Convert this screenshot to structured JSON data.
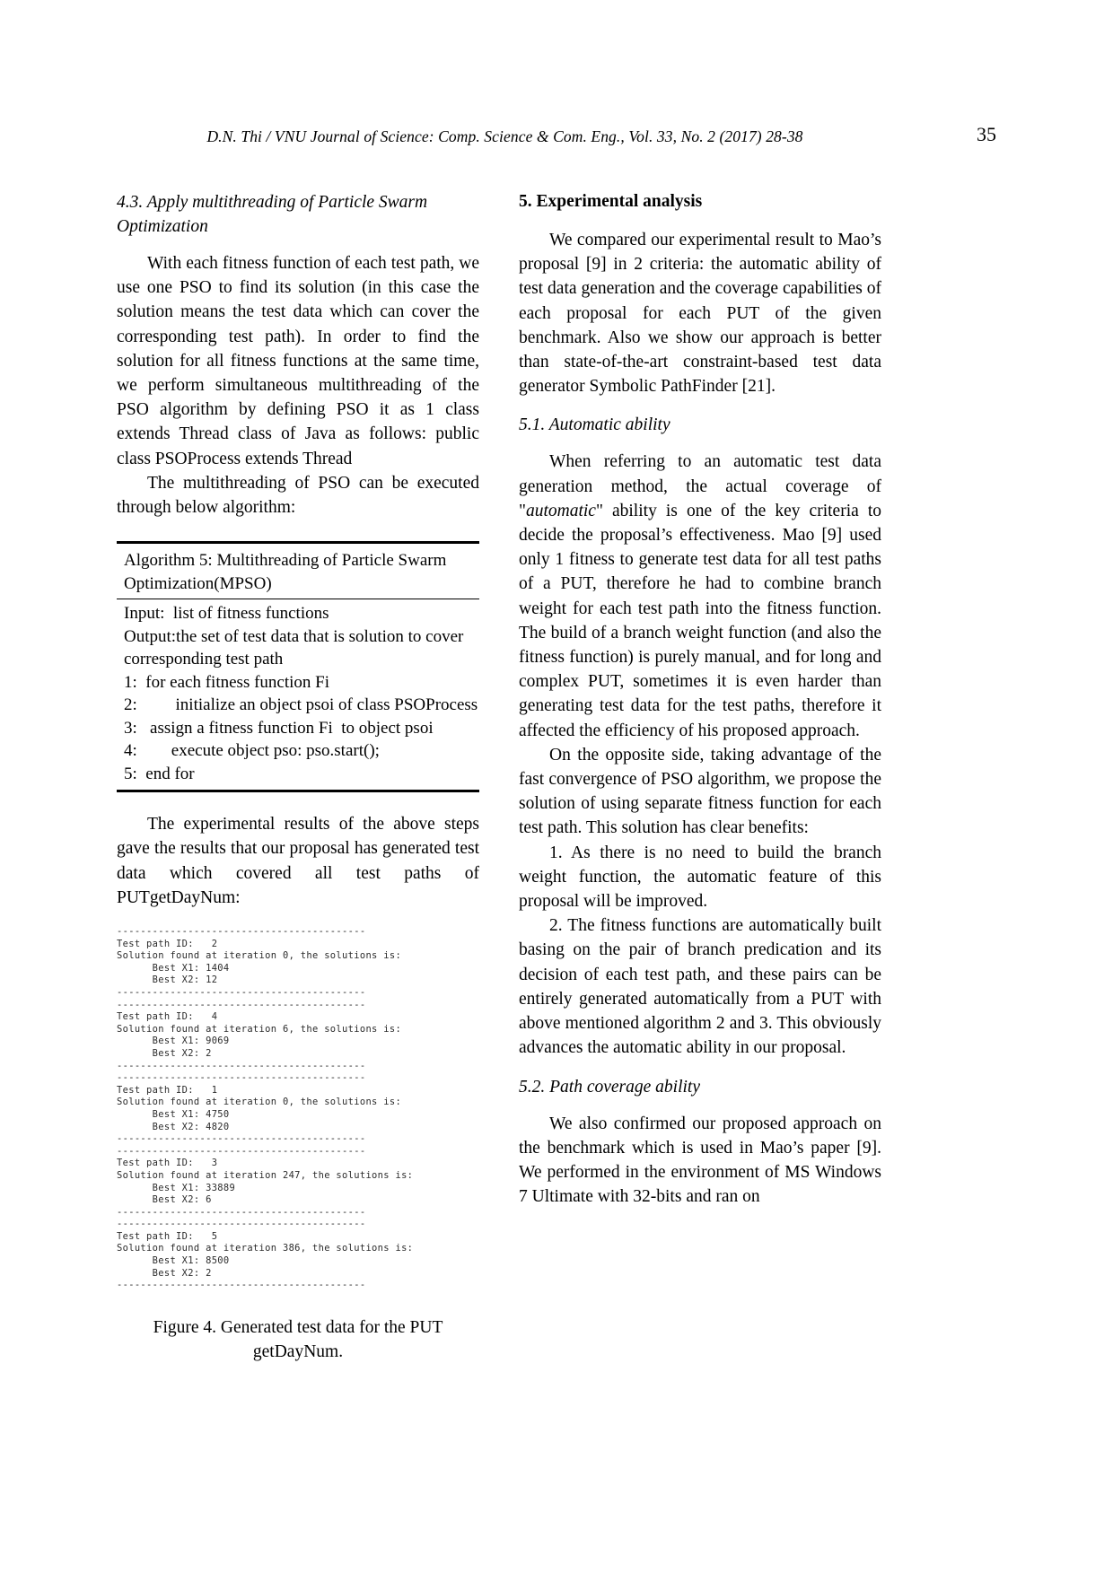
{
  "running_head": {
    "citation": "D.N. Thi / VNU Journal of Science: Comp. Science & Com. Eng., Vol. 33, No. 2 (2017) 28-38",
    "page_number": "35"
  },
  "left_column": {
    "heading_4_3": "4.3. Apply multithreading of Particle Swarm Optimization",
    "para_1": "With each fitness function of each test path, we use one PSO to find its solution (in this case the solution means the test data which can cover the corresponding test path). In order to find the solution for all fitness functions at the same time, we perform simultaneous multithreading of the PSO algorithm by defining PSO it as 1 class extends Thread class of Java as follows: public class PSOProcess extends Thread",
    "para_2": "The multithreading of PSO can be executed through below algorithm:",
    "algorithm": {
      "title": "Algorithm 5: Multithreading of Particle Swarm Optimization(MPSO)",
      "lines": [
        "Input:  list of fitness functions",
        "Output:the set of test data that is solution to cover corresponding test path",
        "1:  for each fitness function Fi",
        "2:         initialize an object psoi of class PSOProcess",
        "3:   assign a fitness function Fi  to object psoi",
        "4:        execute object pso: pso.start();",
        "5:  end for"
      ]
    },
    "para_3": "The experimental results of the above steps gave the results that our proposal has generated test data which covered all test paths of PUTgetDayNum:",
    "console_output": "------------------------------------------\nTest path ID:   2\nSolution found at iteration 0, the solutions is:\n      Best X1: 1404\n      Best X2: 12\n------------------------------------------\n------------------------------------------\nTest path ID:   4\nSolution found at iteration 6, the solutions is:\n      Best X1: 9069\n      Best X2: 2\n------------------------------------------\n------------------------------------------\nTest path ID:   1\nSolution found at iteration 0, the solutions is:\n      Best X1: 4750\n      Best X2: 4820\n------------------------------------------\n------------------------------------------\nTest path ID:   3\nSolution found at iteration 247, the solutions is:\n      Best X1: 33889\n      Best X2: 6\n------------------------------------------\n------------------------------------------\nTest path ID:   5\nSolution found at iteration 386, the solutions is:\n      Best X1: 8500\n      Best X2: 2\n------------------------------------------",
    "figure_caption": "Figure 4. Generated test data for the PUT getDayNum."
  },
  "right_column": {
    "heading_5": "5. Experimental analysis",
    "para_1": "We compared our experimental result to Mao’s proposal [9] in 2 criteria: the automatic ability of test data generation and the coverage capabilities of each proposal for each PUT of the given benchmark. Also we show our approach is better than state-of-the-art constraint-based test data generator Symbolic PathFinder [21].",
    "heading_5_1": "5.1. Automatic ability",
    "para_2_pre": "When referring to an automatic test data generation method, the actual coverage of \"",
    "para_2_italic": "automatic",
    "para_2_post": "\" ability is one of the key criteria to decide the proposal’s effectiveness. Mao [9] used only 1 fitness to generate test data for all test paths of a PUT, therefore he had to combine branch weight for each test path into the fitness function. The build of a branch weight function (and also the fitness function) is purely manual, and for long and complex PUT, sometimes it is even harder than generating test data for the test paths, therefore it affected the efficiency of his proposed approach.",
    "para_3": "On the opposite side, taking advantage of the fast convergence of PSO algorithm, we propose the solution of using separate fitness function for each test path. This solution has clear benefits:",
    "para_4": "1. As there is no need to build the branch weight function, the automatic feature of this proposal will be improved.",
    "para_5": "2. The fitness functions are automatically built basing on the pair of branch predication and its decision of each test path, and these pairs can be entirely generated automatically from a PUT with above mentioned algorithm 2 and 3. This obviously advances the automatic ability in our proposal.",
    "heading_5_2": "5.2. Path coverage ability",
    "para_6": "We also confirmed our proposed approach on the benchmark which is used in Mao’s paper [9]. We performed in the environment of MS Windows 7 Ultimate with 32-bits and ran on"
  }
}
